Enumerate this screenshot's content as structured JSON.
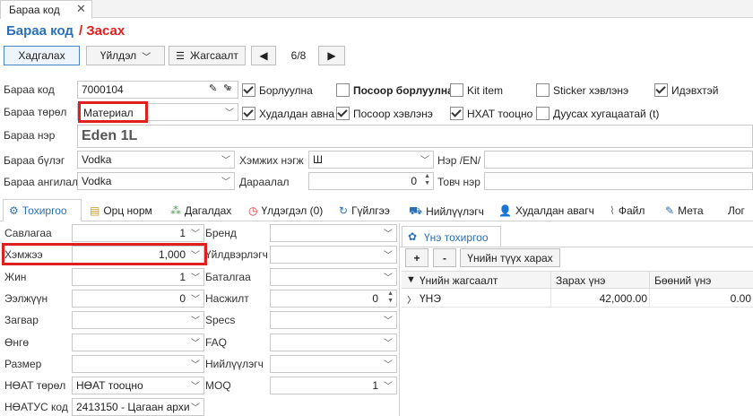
{
  "tab": {
    "title": "Бараа код"
  },
  "header": {
    "title": "Бараа код",
    "action": "/ Засах"
  },
  "toolbar": {
    "save_label": "Хадгалах",
    "action_label": "Үйлдэл",
    "list_label": "Жагсаалт",
    "record_position": "6/8"
  },
  "form": {
    "code_label": "Бараа код",
    "code_value": "7000104",
    "type_label": "Бараа төрөл",
    "type_value": "Материал",
    "name_label": "Бараа нэр",
    "name_value": "Eden 1L",
    "group_label": "Бараа бүлэг",
    "group_value": "Vodka",
    "category_label": "Бараа ангилал",
    "category_value": "Vodka",
    "unit_label": "Хэмжих нэгж",
    "unit_value": "Ш",
    "sequence_label": "Дараалал",
    "sequence_value": "0",
    "name_en_label": "Нэр /EN/",
    "short_name_label": "Товч нэр"
  },
  "checks": {
    "sales": {
      "label": "Борлуулна",
      "checked": true
    },
    "pos_sales": {
      "label": "Посоор борлуулна",
      "checked": false
    },
    "kit": {
      "label": "Kit item",
      "checked": false
    },
    "sticker": {
      "label": "Sticker хэвлэнэ",
      "checked": false
    },
    "active": {
      "label": "Идэвхтэй",
      "checked": true
    },
    "purchase": {
      "label": "Худалдан авна",
      "checked": true
    },
    "pos_print": {
      "label": "Посоор хэвлэнэ",
      "checked": true
    },
    "vat": {
      "label": "НХАТ тооцно",
      "checked": true
    },
    "expiry": {
      "label": "Дуусах хугацаатай (t)",
      "checked": false
    }
  },
  "tabs": [
    {
      "label": "Тохиргоо",
      "icon": "gear-icon"
    },
    {
      "label": "Орц норм",
      "icon": "recipe-icon"
    },
    {
      "label": "Дагалдах",
      "icon": "tree-icon"
    },
    {
      "label": "Үлдэгдэл (0)",
      "icon": "clock-icon"
    },
    {
      "label": "Гүйлгээ",
      "icon": "history-icon"
    },
    {
      "label": "Нийлүүлэгч",
      "icon": "truck-icon"
    },
    {
      "label": "Худалдан авагч",
      "icon": "user-icon"
    },
    {
      "label": "Файл",
      "icon": "paperclip-icon"
    },
    {
      "label": "Мета",
      "icon": "edit-icon"
    },
    {
      "label": "Лог",
      "icon": ""
    }
  ],
  "settings_left": [
    {
      "label": "Савлагаа",
      "value": "1",
      "control": "dropdown"
    },
    {
      "label": "Хэмжээ",
      "value": "1,000",
      "control": "dropdown"
    },
    {
      "label": "Жин",
      "value": "1",
      "control": "dropdown"
    },
    {
      "label": "Ээлжүүн",
      "value": "0",
      "control": "dropdown"
    },
    {
      "label": "Загвар",
      "value": "",
      "control": "dropdown"
    },
    {
      "label": "Өнгө",
      "value": "",
      "control": "dropdown"
    },
    {
      "label": "Размер",
      "value": "",
      "control": "dropdown"
    },
    {
      "label": "НӨАТ төрөл",
      "value": "НӨАТ тооцно",
      "control": "dropdown"
    },
    {
      "label": "НӨАТУС код",
      "value": "2413150 - Цагаан архи",
      "control": "dropdown"
    }
  ],
  "settings_mid": [
    {
      "label": "Бренд",
      "value": "",
      "control": "dropdown"
    },
    {
      "label": "Үйлдвэрлэгч",
      "value": "",
      "control": "dropdown"
    },
    {
      "label": "Баталгаа",
      "value": "",
      "control": "dropdown"
    },
    {
      "label": "Насжилт",
      "value": "0",
      "control": "spin"
    },
    {
      "label": "Specs",
      "value": "",
      "control": "dropdown"
    },
    {
      "label": "FAQ",
      "value": "",
      "control": "dropdown"
    },
    {
      "label": "Нийлүүлэгч",
      "value": "",
      "control": "dropdown"
    },
    {
      "label": "MOQ",
      "value": "1",
      "control": "dropdown"
    }
  ],
  "price_panel": {
    "tab_label": "Үнэ тохиргоо",
    "add_label": "+",
    "remove_label": "-",
    "history_label": "Үнийн түүх харах",
    "columns": [
      "Үнийн жагсаалт",
      "Зарах үнэ",
      "Бөөний үнэ"
    ],
    "rows": [
      {
        "name": "ҮНЭ",
        "price": "42,000.00",
        "wholesale": "0.00"
      }
    ]
  },
  "colors": {
    "accent": "#2b6fb6",
    "highlight": "#e0201e"
  }
}
